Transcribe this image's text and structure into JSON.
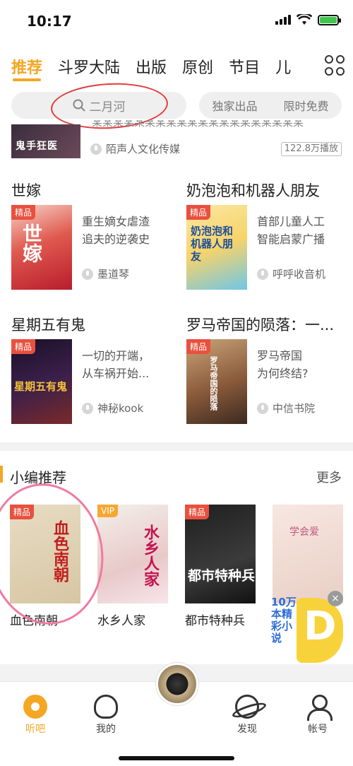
{
  "status": {
    "time": "10:17"
  },
  "tabs": [
    {
      "label": "推荐"
    },
    {
      "label": "斗罗大陆"
    },
    {
      "label": "出版"
    },
    {
      "label": "原创"
    },
    {
      "label": "节目"
    },
    {
      "label": "儿"
    }
  ],
  "search": {
    "placeholder": "二月河",
    "pill_left": "独家出品",
    "pill_right": "限时免费"
  },
  "top_item": {
    "cover_text": "鬼手狂医",
    "author": "陌声人文化传媒",
    "plays": "122.8万播放"
  },
  "books": [
    {
      "title": "世嫁",
      "badge": "精品",
      "desc1": "重生嫡女虐渣",
      "desc2": "追夫的逆袭史",
      "author": "墨道琴",
      "cover_text": "世嫁"
    },
    {
      "title": "奶泡泡和机器人朋友",
      "badge": "精品",
      "desc1": "首部儿童人工",
      "desc2": "智能启蒙广播",
      "author": "呼呼收音机",
      "cover_text": "奶泡泡和机器人朋友"
    },
    {
      "title": "星期五有鬼",
      "badge": "精品",
      "desc1": "一切的开端，",
      "desc2": "从车祸开始...",
      "author": "神秘kook",
      "cover_text": "星期五有鬼"
    },
    {
      "title": "罗马帝国的陨落：一...",
      "badge": "精品",
      "desc1": "罗马帝国",
      "desc2": "为何终结?",
      "author": "中信书院",
      "cover_text": "罗马帝国的陨落"
    }
  ],
  "picks": {
    "title": "小编推荐",
    "more": "更多",
    "items": [
      {
        "title": "血色南朝",
        "badge": "精品",
        "cover_text": "血色南朝"
      },
      {
        "title": "水乡人家",
        "badge": "VIP",
        "cover_text": "水乡人家"
      },
      {
        "title": "都市特种兵",
        "badge": "精品",
        "cover_text": "都市特种兵"
      }
    ],
    "fourth_cover_text": "学会爱"
  },
  "promo": {
    "text": "10万本精彩小说",
    "letter": "D",
    "close": "×"
  },
  "nav": [
    {
      "label": "听吧"
    },
    {
      "label": "我的"
    },
    {
      "label": "发现"
    },
    {
      "label": "帐号"
    }
  ],
  "colors": {
    "accent": "#f5a623",
    "badge": "#e9503e",
    "vip": "#f6a833"
  }
}
